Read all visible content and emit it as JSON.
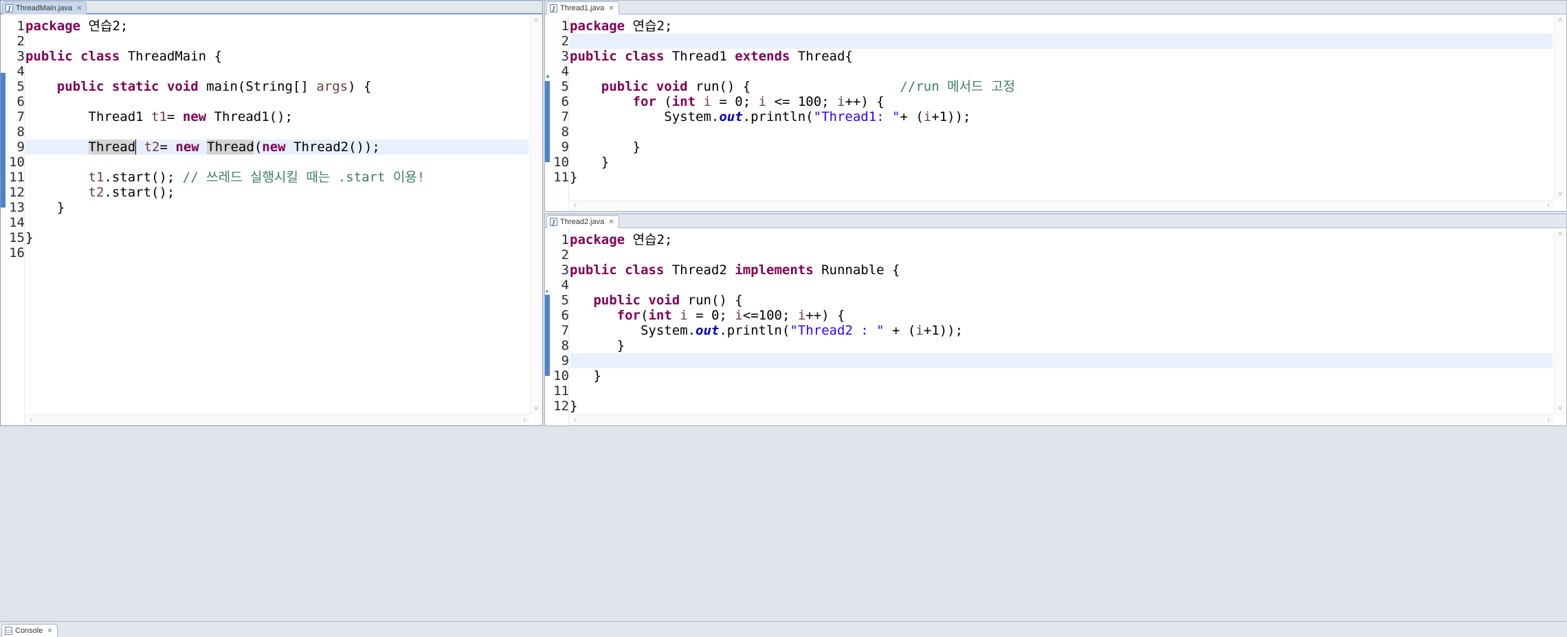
{
  "editors": {
    "main": {
      "tab_label": "ThreadMain.java",
      "tab_icon": "java-file-icon",
      "lines": [
        {
          "n": "1",
          "html": "<span class='kw'>package</span> 연습2;"
        },
        {
          "n": "2",
          "html": ""
        },
        {
          "n": "3",
          "html": "<span class='kw'>public</span> <span class='kw'>class</span> ThreadMain {"
        },
        {
          "n": "4",
          "html": ""
        },
        {
          "n": "5",
          "html": "    <span class='kw'>public</span> <span class='kw'>static</span> <span class='kw'>void</span> main(String[] <span class='var'>args</span>) {"
        },
        {
          "n": "6",
          "html": ""
        },
        {
          "n": "7",
          "html": "        Thread1 <span class='var'>t1</span>= <span class='kw'>new</span> Thread1();"
        },
        {
          "n": "8",
          "html": ""
        },
        {
          "n": "9",
          "html": "        <span class='occ'>Thread</span><span class='caret'></span> <span class='var'>t2</span>= <span class='kw'>new</span> <span class='occ'>Thread</span>(<span class='kw'>new</span> Thread2());"
        },
        {
          "n": "10",
          "html": ""
        },
        {
          "n": "11",
          "html": "        <span class='var'>t1</span>.start(); <span class='cmt'>// 쓰레드 실행시킬 때는 .start 이용!</span>"
        },
        {
          "n": "12",
          "html": "        <span class='var'>t2</span>.start();"
        },
        {
          "n": "13",
          "html": "    }"
        },
        {
          "n": "14",
          "html": ""
        },
        {
          "n": "15",
          "html": "}"
        },
        {
          "n": "16",
          "html": ""
        }
      ]
    },
    "thread1": {
      "tab_label": "Thread1.java",
      "tab_icon": "java-file-icon",
      "lines": [
        {
          "n": "1",
          "html": "<span class='kw'>package</span> 연습2;"
        },
        {
          "n": "2",
          "html": ""
        },
        {
          "n": "3",
          "html": "<span class='kw'>public</span> <span class='kw'>class</span> Thread1 <span class='kw'>extends</span> Thread{"
        },
        {
          "n": "4",
          "html": ""
        },
        {
          "n": "5",
          "html": "    <span class='kw'>public</span> <span class='kw'>void</span> run() {                   <span class='cmt'>//run 메서드 고정</span>"
        },
        {
          "n": "6",
          "html": "        <span class='kw'>for</span> (<span class='kw'>int</span> <span class='var'>i</span> = 0; <span class='var'>i</span> &lt;= 100; <span class='var'>i</span>++) {"
        },
        {
          "n": "7",
          "html": "            System.<span class='fld'>out</span>.println(<span class='str'>\"Thread1: \"</span>+ (<span class='var'>i</span>+1));"
        },
        {
          "n": "8",
          "html": ""
        },
        {
          "n": "9",
          "html": "        }"
        },
        {
          "n": "10",
          "html": "    }"
        },
        {
          "n": "11",
          "html": "}"
        }
      ]
    },
    "thread2": {
      "tab_label": "Thread2.java",
      "tab_icon": "java-file-icon",
      "lines": [
        {
          "n": "1",
          "html": "<span class='kw'>package</span> 연습2;"
        },
        {
          "n": "2",
          "html": ""
        },
        {
          "n": "3",
          "html": "<span class='kw'>public</span> <span class='kw'>class</span> Thread2 <span class='kw'>implements</span> Runnable {"
        },
        {
          "n": "4",
          "html": ""
        },
        {
          "n": "5",
          "html": "   <span class='kw'>public</span> <span class='kw'>void</span> run() {"
        },
        {
          "n": "6",
          "html": "      <span class='kw'>for</span>(<span class='kw'>int</span> <span class='var'>i</span> = 0; <span class='var'>i</span>&lt;=100; <span class='var'>i</span>++) {"
        },
        {
          "n": "7",
          "html": "         System.<span class='fld'>out</span>.println(<span class='str'>\"Thread2 : \"</span> + (<span class='var'>i</span>+1));"
        },
        {
          "n": "8",
          "html": "      }"
        },
        {
          "n": "9",
          "html": ""
        },
        {
          "n": "10",
          "html": "   }"
        },
        {
          "n": "11",
          "html": ""
        },
        {
          "n": "12",
          "html": "}"
        }
      ]
    }
  },
  "console": {
    "tab_label": "Console",
    "tab_icon": "console-icon"
  },
  "colors": {
    "keyword": "#7f0055",
    "string": "#2a00ff",
    "comment": "#3f7f5f",
    "current_line": "#e8f0fd",
    "change_bar": "#4c83c9"
  }
}
